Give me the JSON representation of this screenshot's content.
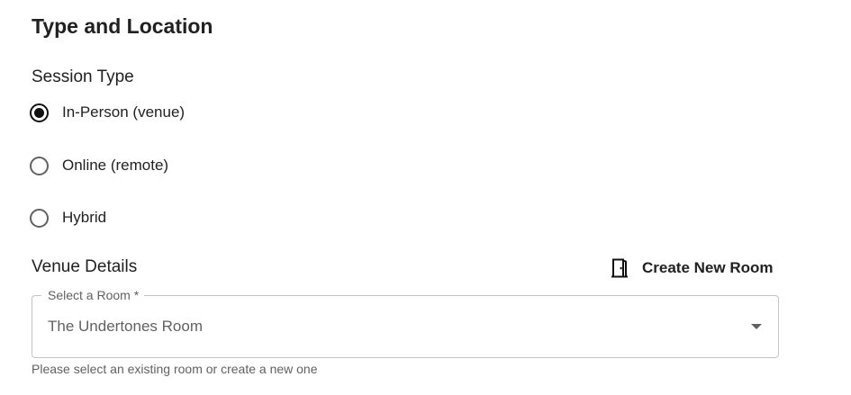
{
  "section": {
    "title": "Type and Location"
  },
  "session_type": {
    "label": "Session Type",
    "options": [
      {
        "label": "In-Person (venue)",
        "checked": true
      },
      {
        "label": "Online (remote)",
        "checked": false
      },
      {
        "label": "Hybrid",
        "checked": false
      }
    ]
  },
  "venue": {
    "label": "Venue Details",
    "create_button_label": "Create New Room",
    "create_button_icon": "door-icon",
    "select_label": "Select a Room *",
    "select_value": "The Undertones Room",
    "helper_text": "Please select an existing room or create a new one"
  }
}
